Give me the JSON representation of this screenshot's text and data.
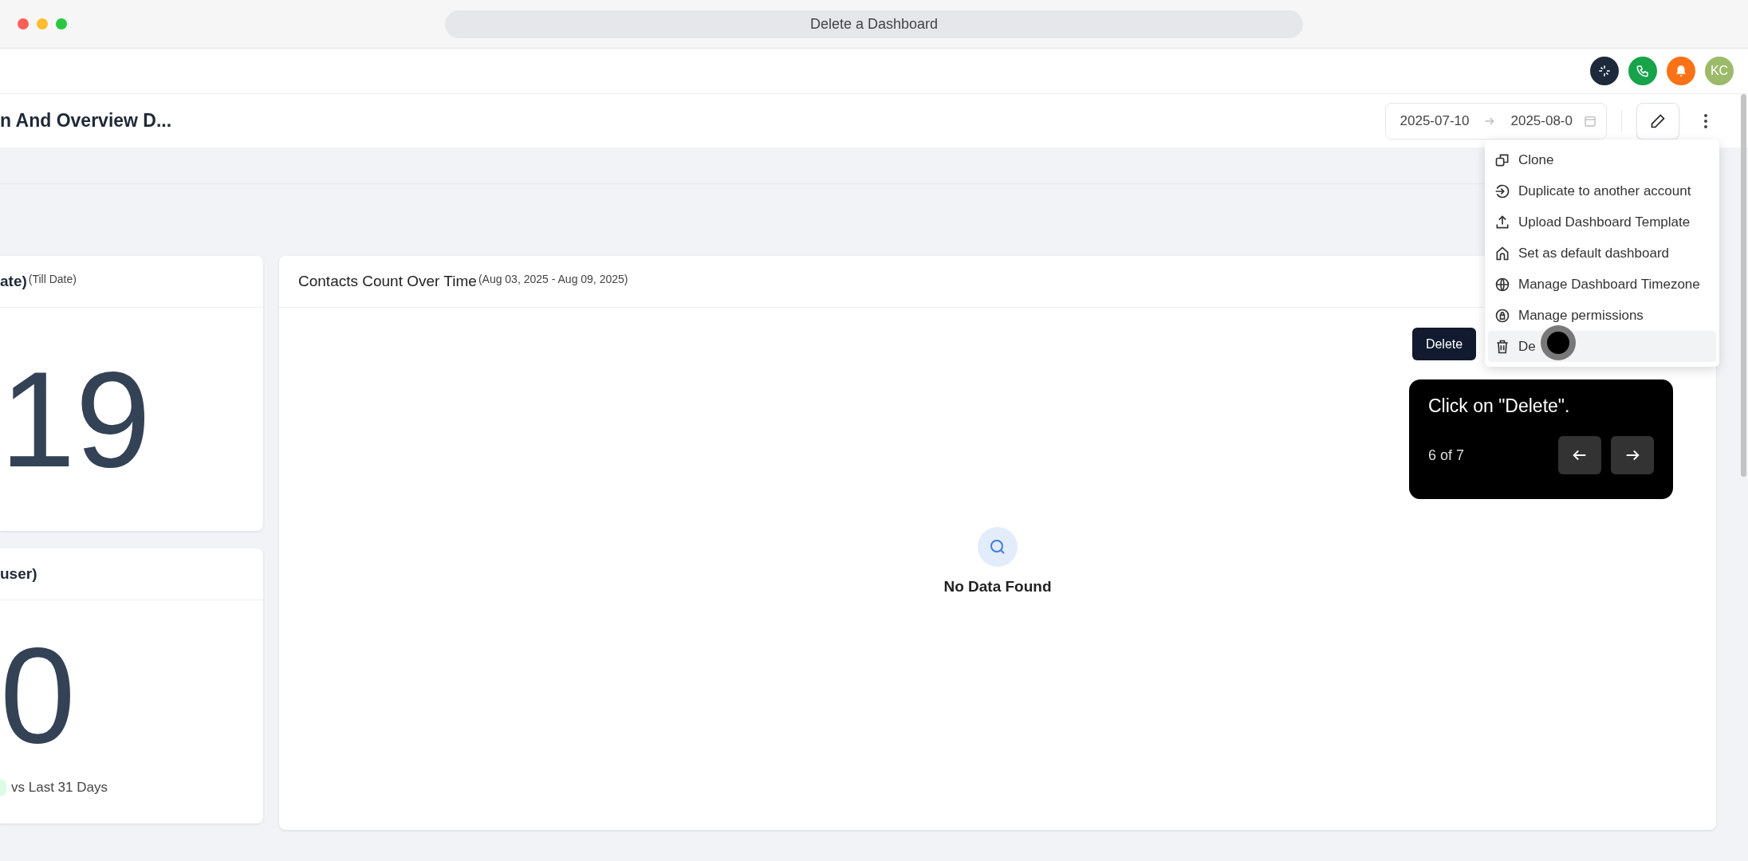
{
  "window": {
    "title": "Delete a Dashboard"
  },
  "top_bar": {
    "avatar_initials": "KC"
  },
  "header": {
    "title": "n And Overview D...",
    "date_start": "2025-07-10",
    "date_end": "2025-08-0"
  },
  "cards": [
    {
      "title": "ate)",
      "subtitle": "(Till Date)",
      "value": "19"
    },
    {
      "title": "user)",
      "value": "0",
      "comparison": "vs Last 31 Days"
    }
  ],
  "chart_card": {
    "title": "Contacts Count Over Time",
    "subtitle": "(Aug 03, 2025 - Aug 09, 2025)",
    "empty_text": "No Data Found"
  },
  "menu": {
    "items": [
      {
        "label": "Clone",
        "highlighted": false
      },
      {
        "label": "Duplicate to another account",
        "highlighted": false
      },
      {
        "label": "Upload Dashboard Template",
        "highlighted": false
      },
      {
        "label": "Set as default dashboard",
        "highlighted": false
      },
      {
        "label": "Manage Dashboard Timezone",
        "highlighted": false
      },
      {
        "label": "Manage permissions",
        "highlighted": false
      },
      {
        "label": "De",
        "highlighted": true
      }
    ]
  },
  "tooltip": {
    "text": "Delete"
  },
  "tour": {
    "text": "Click on \"Delete\".",
    "step": "6 of 7"
  }
}
